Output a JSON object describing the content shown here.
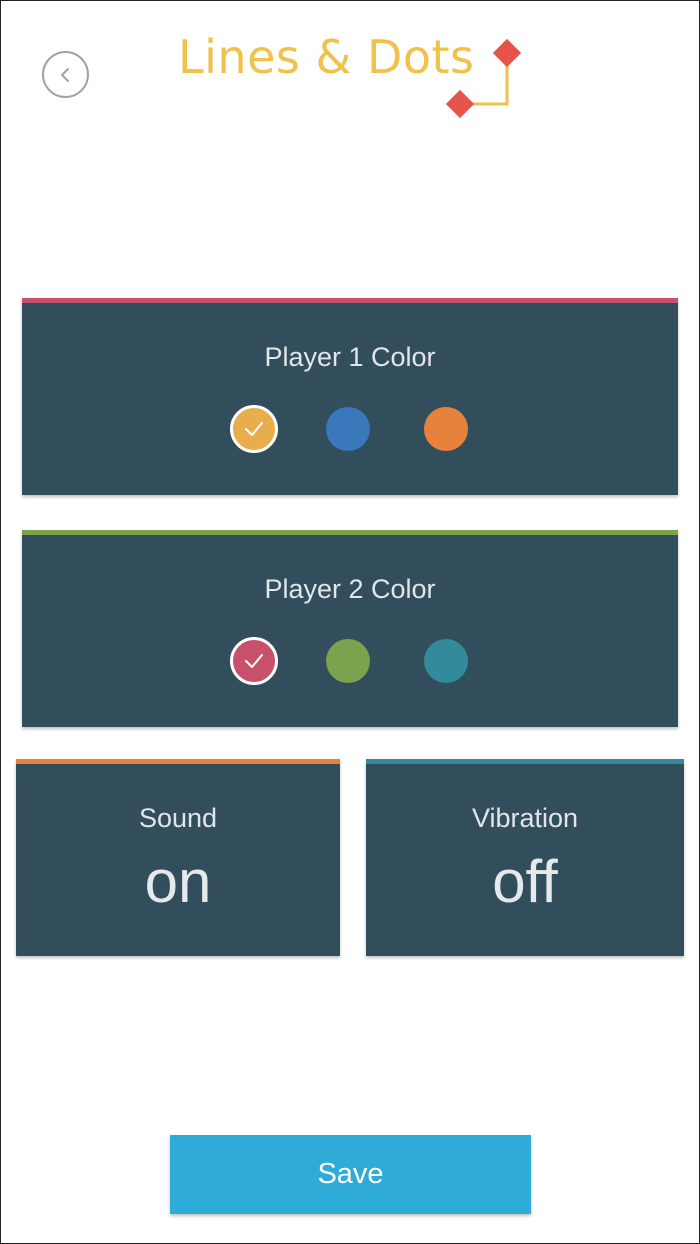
{
  "header": {
    "title": "Lines & Dots",
    "back_icon": "chevron-left-icon"
  },
  "colors": {
    "title": "#f0c14b",
    "card_bg": "#324d5b",
    "logo_diamond": "#e5534b",
    "logo_line": "#f0c14b",
    "save_bg": "#2eabd6"
  },
  "player1": {
    "title": "Player 1 Color",
    "accent": "#c9506a",
    "selected_index": 0,
    "swatches": [
      "#eaad4b",
      "#3a78bc",
      "#e7823c"
    ]
  },
  "player2": {
    "title": "Player 2 Color",
    "accent": "#7ba24d",
    "selected_index": 0,
    "swatches": [
      "#c9506a",
      "#7ba24d",
      "#338a9a"
    ]
  },
  "sound": {
    "title": "Sound",
    "value": "on",
    "accent": "#e7823c"
  },
  "vibration": {
    "title": "Vibration",
    "value": "off",
    "accent": "#338a9a"
  },
  "save": {
    "label": "Save"
  }
}
